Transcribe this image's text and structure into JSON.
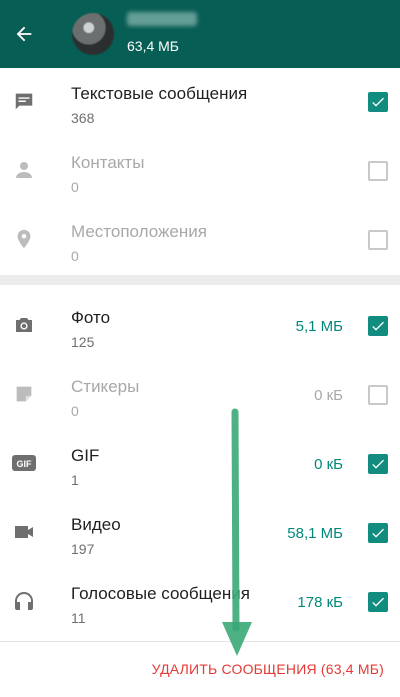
{
  "header": {
    "total_size": "63,4 МБ",
    "back_icon": "arrow-left-icon",
    "background_color": "#075e54"
  },
  "categories": [
    {
      "icon": "message-icon",
      "title": "Текстовые сообщения",
      "count": "368",
      "size": "",
      "checked": true,
      "enabled": true
    },
    {
      "icon": "person-icon",
      "title": "Контакты",
      "count": "0",
      "size": "",
      "checked": false,
      "enabled": false
    },
    {
      "icon": "location-pin-icon",
      "title": "Местоположения",
      "count": "0",
      "size": "",
      "checked": false,
      "enabled": false
    },
    {
      "icon": "camera-icon",
      "title": "Фото",
      "count": "125",
      "size": "5,1 МБ",
      "checked": true,
      "enabled": true
    },
    {
      "icon": "sticker-icon",
      "title": "Стикеры",
      "count": "0",
      "size": "0 кБ",
      "checked": false,
      "enabled": false
    },
    {
      "icon": "gif-icon",
      "title": "GIF",
      "count": "1",
      "size": "0 кБ",
      "checked": true,
      "enabled": true
    },
    {
      "icon": "video-camera-icon",
      "title": "Видео",
      "count": "197",
      "size": "58,1 МБ",
      "checked": true,
      "enabled": true
    },
    {
      "icon": "headphones-icon",
      "title": "Голосовые сообщения",
      "count": "11",
      "size": "178 кБ",
      "checked": true,
      "enabled": true
    }
  ],
  "footer": {
    "delete_label": "УДАЛИТЬ СООБЩЕНИЯ (63,4 МБ)",
    "delete_color": "#e53935"
  },
  "colors": {
    "accent": "#00897b",
    "checkbox_on": "#128c7e",
    "annotation_arrow": "#3aa876"
  }
}
